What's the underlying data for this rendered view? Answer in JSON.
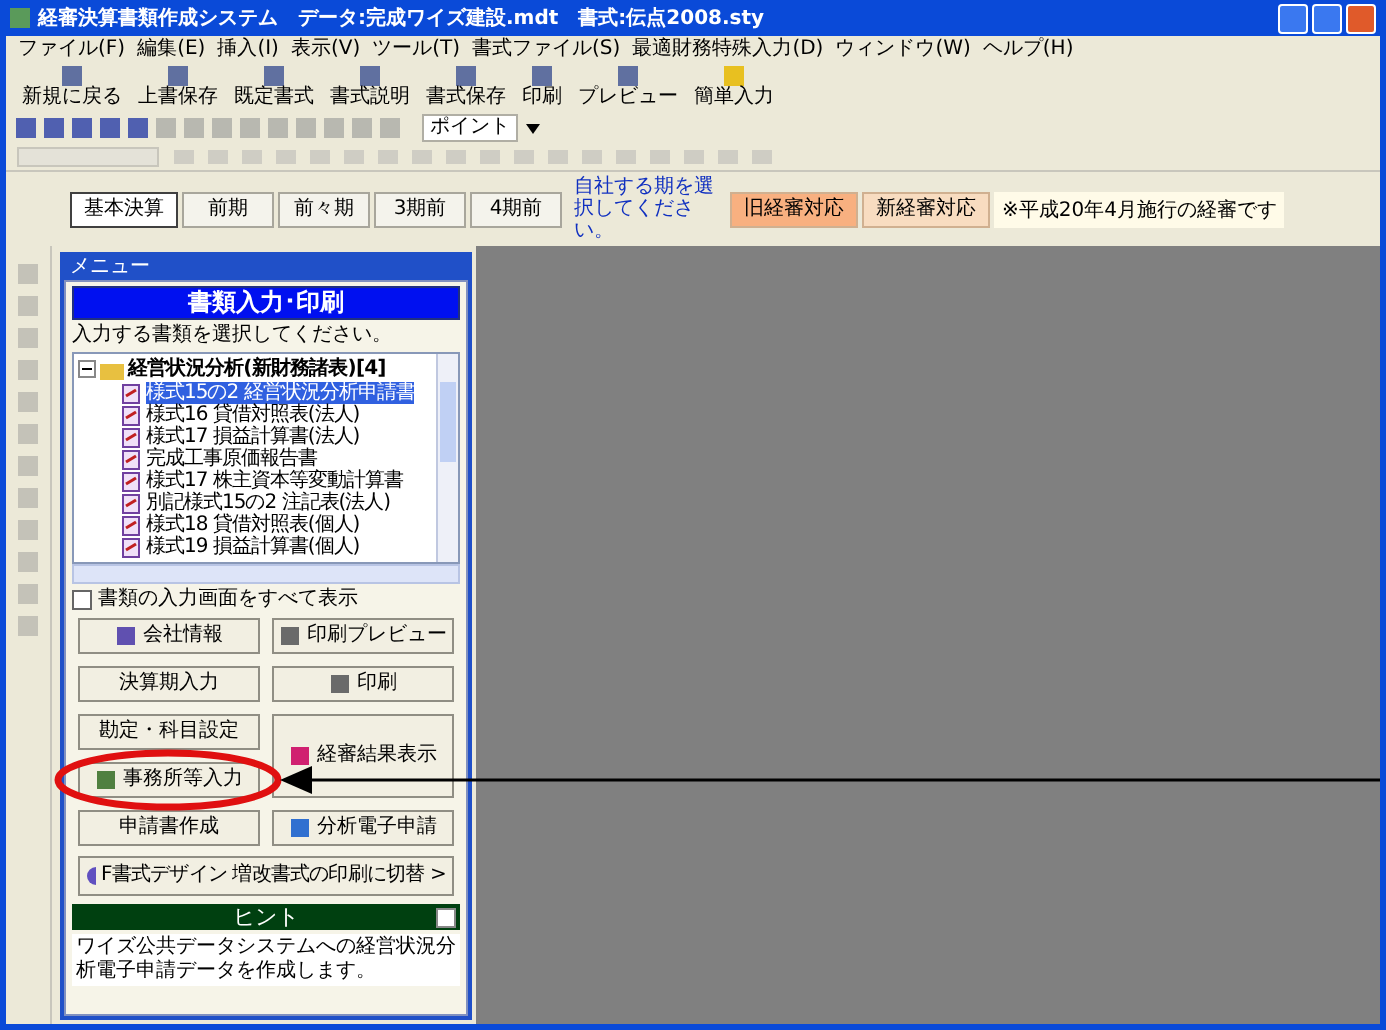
{
  "window": {
    "title": "経審決算書類作成システム　データ:完成ワイズ建設.mdt　書式:伝点2008.sty"
  },
  "menu": [
    "ファイル(F)",
    "編集(E)",
    "挿入(I)",
    "表示(V)",
    "ツール(T)",
    "書式ファイル(S)",
    "最適財務特殊入力(D)",
    "ウィンドウ(W)",
    "ヘルプ(H)"
  ],
  "toolbar": [
    "新規に戻る",
    "上書保存",
    "既定書式",
    "書式説明",
    "書式保存",
    "印刷",
    "プレビュー",
    "簡単入力"
  ],
  "toolbar2": {
    "dropdown": "ポイント"
  },
  "period_tabs": [
    {
      "label": "基本決算",
      "selected": true
    },
    {
      "label": "前期",
      "selected": false
    },
    {
      "label": "前々期",
      "selected": false
    },
    {
      "label": "3期前",
      "selected": false
    },
    {
      "label": "4期前",
      "selected": false
    }
  ],
  "period_hint": "自社する期を選択してください。",
  "mode_buttons": [
    {
      "label": "旧経審対応",
      "selected": true
    },
    {
      "label": "新経審対応",
      "selected": false
    }
  ],
  "notice": "※平成20年4月施行の経審です",
  "menu_panel": {
    "title": "メニュー",
    "heading": "書類入力･印刷",
    "instruction": "入力する書類を選択してください。",
    "tree": {
      "label": "経営状況分析(新財務諸表)[4]",
      "expanded": true,
      "children": [
        {
          "label": "様式15の2 経営状況分析申請書",
          "selected": true
        },
        {
          "label": "様式16 貸借対照表(法人)",
          "selected": false
        },
        {
          "label": "様式17 損益計算書(法人)",
          "selected": false
        },
        {
          "label": "完成工事原価報告書",
          "selected": false
        },
        {
          "label": "様式17 株主資本等変動計算書",
          "selected": false
        },
        {
          "label": "別記様式15の2 注記表(法人)",
          "selected": false
        },
        {
          "label": "様式18 貸借対照表(個人)",
          "selected": false
        },
        {
          "label": "様式19 損益計算書(個人)",
          "selected": false
        }
      ]
    },
    "show_all": {
      "label": "書類の入力画面をすべて表示",
      "checked": false
    },
    "left_buttons": [
      {
        "label": "会社情報",
        "kind": "icon"
      },
      {
        "label": "決算期入力",
        "kind": "plain"
      },
      {
        "label": "勘定・科目設定",
        "kind": "plain"
      },
      {
        "label": "事務所等入力",
        "kind": "icon"
      },
      {
        "label": "申請書作成",
        "kind": "plain"
      }
    ],
    "right_buttons": [
      {
        "label": "印刷プレビュー",
        "kind": "icon"
      },
      {
        "label": "印刷",
        "kind": "icon"
      },
      {
        "label": "経審結果表示",
        "kind": "tall"
      },
      {
        "label": "分析電子申請",
        "kind": "icon"
      }
    ],
    "switch_button": "F書式デザイン 増改書式の印刷に切替 >",
    "hint": {
      "title": "ヒント",
      "text": "ワイズ公共データシステムへの経営状況分析電子申請データを作成します。"
    }
  }
}
